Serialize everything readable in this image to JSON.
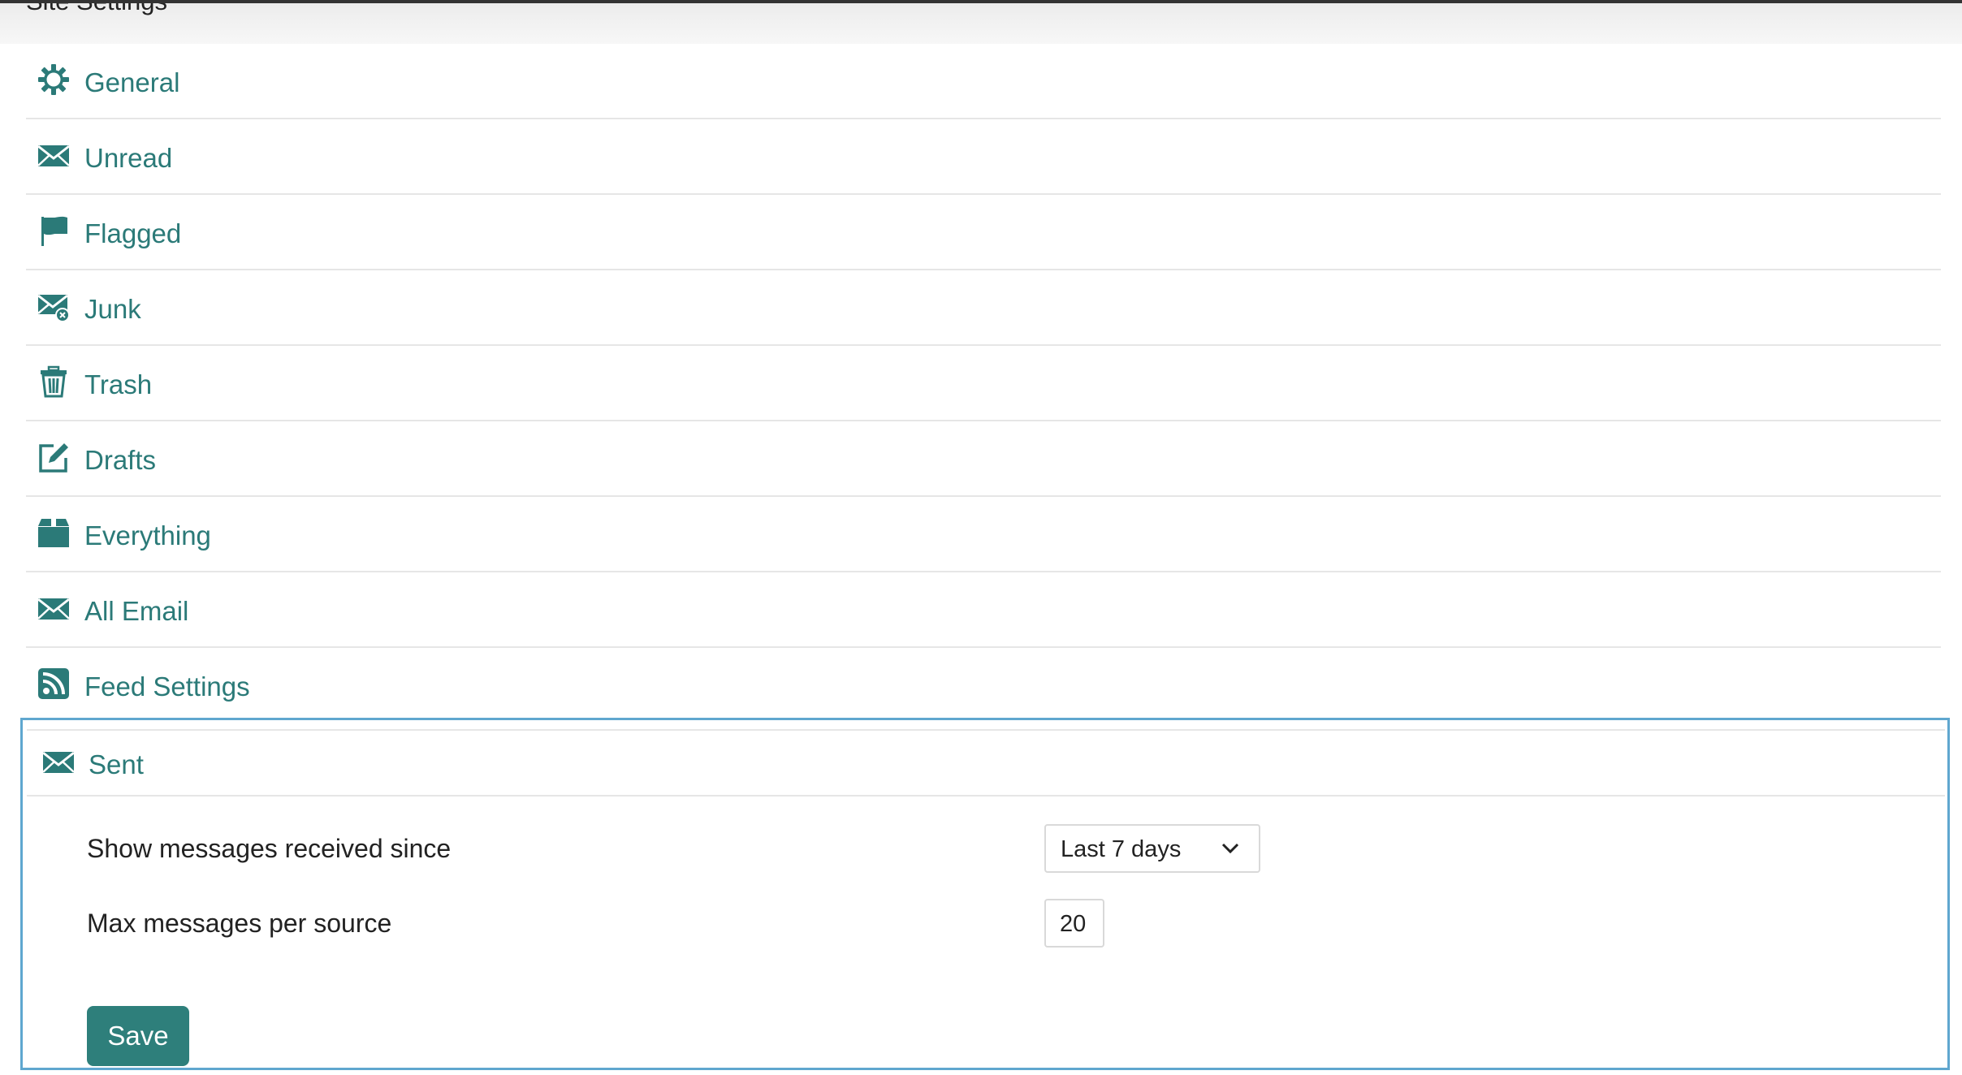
{
  "page": {
    "title": "Site Settings"
  },
  "colors": {
    "accent": "#2b7a78",
    "button": "#2e7f7b",
    "focus_border": "#5fa7cf"
  },
  "sections": [
    {
      "label": "General",
      "icon": "gear-icon"
    },
    {
      "label": "Unread",
      "icon": "envelope-icon"
    },
    {
      "label": "Flagged",
      "icon": "flag-icon"
    },
    {
      "label": "Junk",
      "icon": "junk-envelope-icon"
    },
    {
      "label": "Trash",
      "icon": "trash-icon"
    },
    {
      "label": "Drafts",
      "icon": "edit-icon"
    },
    {
      "label": "Everything",
      "icon": "box-icon"
    },
    {
      "label": "All Email",
      "icon": "envelope-icon"
    },
    {
      "label": "Feed Settings",
      "icon": "rss-icon"
    }
  ],
  "sent": {
    "label": "Sent",
    "icon": "envelope-icon",
    "settings": {
      "since_label": "Show messages received since",
      "since_value": "Last 7 days",
      "max_label": "Max messages per source",
      "max_value": "20"
    },
    "save_label": "Save"
  }
}
